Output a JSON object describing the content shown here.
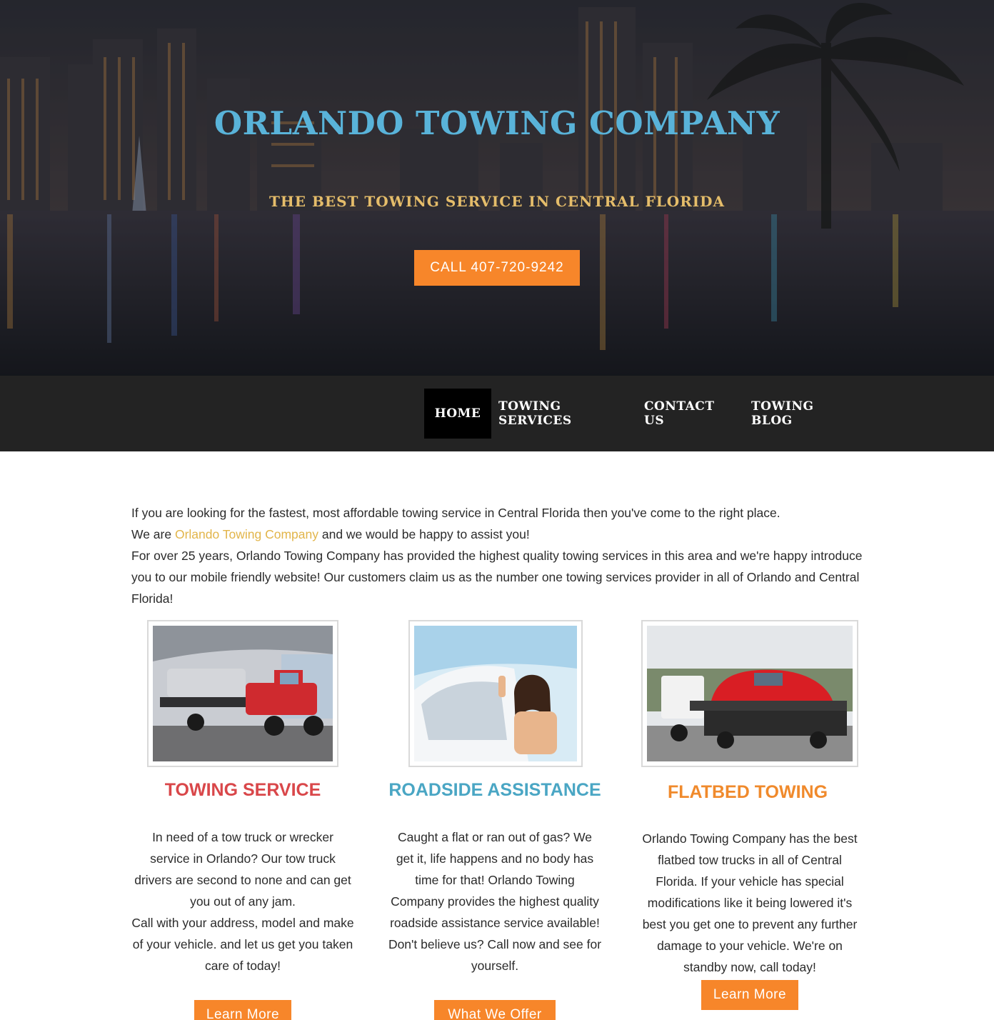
{
  "hero": {
    "title": "ORLANDO TOWING COMPANY",
    "subtitle": "THE BEST TOWING SERVICE IN CENTRAL FLORIDA",
    "call_button": "CALL 407-720-9242"
  },
  "nav": {
    "items": [
      {
        "label": "HOME",
        "active": true
      },
      {
        "label": "TOWING SERVICES",
        "active": false
      },
      {
        "label": "CONTACT US",
        "active": false
      },
      {
        "label": "TOWING BLOG",
        "active": false
      }
    ]
  },
  "intro": {
    "line1": "If you are looking for the fastest, most affordable towing service in Central Florida then you've come to the right place.",
    "line2_before": "We are ",
    "line2_link": "Orlando Towing Company",
    "line2_after": " and we would be happy to assist you!",
    "line3": "For over 25 years, Orlando Towing Company has provided the highest quality towing services in this area and we're happy introduce you to our mobile friendly website! Our customers claim us as the number one towing services provider in all of Orlando and Central Florida!"
  },
  "columns": [
    {
      "heading": "TOWING SERVICE",
      "heading_color": "#d9474a",
      "text": "In need of a tow truck or wrecker service in Orlando? Our tow truck drivers are second to none and can get you out of any jam.\nCall with your address, model and make of your vehicle. and let us get you taken care of today!",
      "button": "Learn More",
      "image": "red-tow-truck-photo"
    },
    {
      "heading": "ROADSIDE ASSISTANCE",
      "heading_color": "#4aa6c4",
      "text": "Caught a flat or ran out of gas? We get it, life happens and no body has time for that! Orlando Towing Company provides the highest quality roadside assistance service available! Don't believe us? Call now and see for yourself.",
      "button": "What We Offer",
      "image": "woman-in-car-photo"
    },
    {
      "heading": "FLATBED TOWING",
      "heading_color": "#f08a2c",
      "text": "Orlando Towing Company has the best flatbed tow trucks in all of Central Florida. If your vehicle has special modifications like it being lowered it's best you get one to prevent any further damage to your vehicle. We're on standby now, call today!",
      "button": "Learn More",
      "image": "flatbed-sports-car-photo"
    }
  ],
  "colors": {
    "accent": "#f7862a",
    "title_blue": "#59b3d9",
    "subtitle_gold": "#e5bd6a",
    "nav_bg": "#232323",
    "link_gold": "#e2b54a"
  }
}
